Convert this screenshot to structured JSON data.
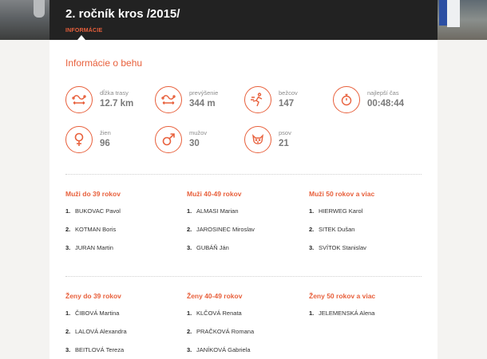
{
  "header": {
    "title": "2. ročník kros /2015/",
    "active_tab": "INFORMÁCIE"
  },
  "info": {
    "section_title": "Informácie o behu",
    "stats": [
      {
        "icon": "route-icon",
        "label": "dĺžka trasy",
        "value": "12.7 km"
      },
      {
        "icon": "elevation-icon",
        "label": "prevýšenie",
        "value": "344 m"
      },
      {
        "icon": "runner-icon",
        "label": "bežcov",
        "value": "147"
      },
      {
        "icon": "stopwatch-icon",
        "label": "najlepší čas",
        "value": "00:48:44"
      },
      {
        "icon": "female-icon",
        "label": "žien",
        "value": "96"
      },
      {
        "icon": "male-icon",
        "label": "mužov",
        "value": "30"
      },
      {
        "icon": "dog-icon",
        "label": "psov",
        "value": "21"
      }
    ]
  },
  "men": [
    {
      "title": "Muži do 39 rokov",
      "entries": [
        "BUKOVAC Pavol",
        "KOTMAN Boris",
        "JURAN Martin"
      ]
    },
    {
      "title": "Muži 40-49 rokov",
      "entries": [
        "ALMASI Marian",
        "JAROSINEC Miroslav",
        "GUBÁŇ Ján"
      ]
    },
    {
      "title": "Muži 50 rokov a viac",
      "entries": [
        "HIERWEG Karol",
        "SITEK Dušan",
        "SVÍTOK Stanislav"
      ]
    }
  ],
  "women": [
    {
      "title": "Ženy do 39 rokov",
      "entries": [
        "ČIBOVÁ Martina",
        "LALOVÁ Alexandra",
        "BEITLOVÁ Tereza"
      ]
    },
    {
      "title": "Ženy 40-49 rokov",
      "entries": [
        "KLČOVÁ Renata",
        "PRAČKOVÁ Romana",
        "JANÍKOVÁ Gabriela"
      ]
    },
    {
      "title": "Ženy 50 rokov a viac",
      "entries": [
        "JELEMENSKÁ Alena"
      ]
    }
  ],
  "rank_numbers": [
    "1.",
    "2.",
    "3."
  ],
  "colors": {
    "accent": "#e8603c",
    "header_bg": "#222222"
  }
}
